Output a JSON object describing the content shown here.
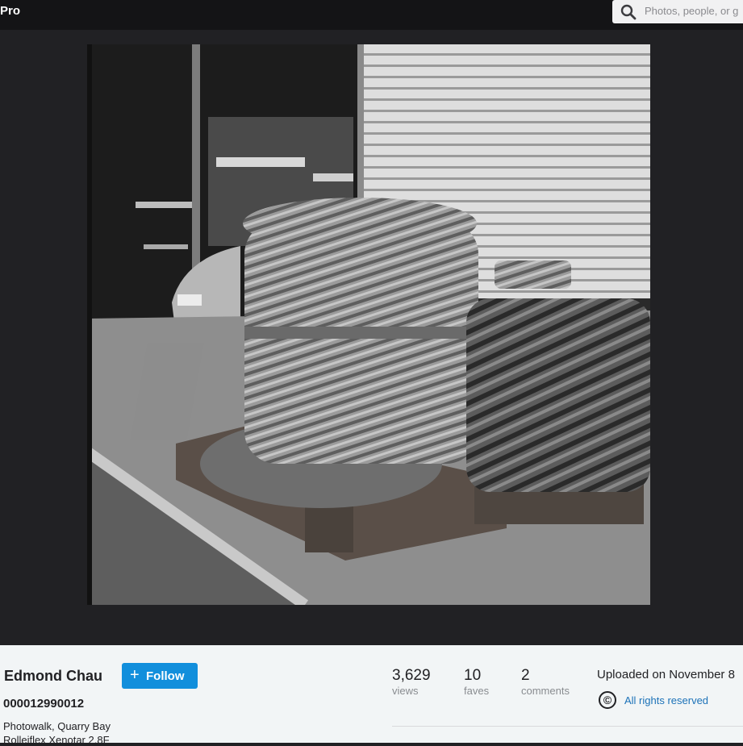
{
  "header": {
    "brand": "Pro",
    "search_placeholder": "Photos, people, or g"
  },
  "photo": {
    "alt": "Black and white photo of coiled ropes on wooden pallets in Quarry Bay",
    "thumbnail_count": 7
  },
  "owner": {
    "name": "Edmond Chau",
    "follow_label": "Follow"
  },
  "photo_info": {
    "title": "000012990012",
    "description_line1": "Photowalk, Quarry Bay",
    "description_line2": "Rolleiflex Xenotar 2.8F"
  },
  "stats": {
    "views": {
      "value": "3,629",
      "label": "views"
    },
    "faves": {
      "value": "10",
      "label": "faves"
    },
    "comments": {
      "value": "2",
      "label": "comments"
    }
  },
  "meta": {
    "uploaded": "Uploaded on November 8",
    "license_icon": "©",
    "license": "All rights reserved"
  },
  "colors": {
    "topbar": "#141416",
    "stage": "#212124",
    "accent": "#128fdc",
    "link": "#1c72b8",
    "info_bg": "#f2f5f6"
  }
}
